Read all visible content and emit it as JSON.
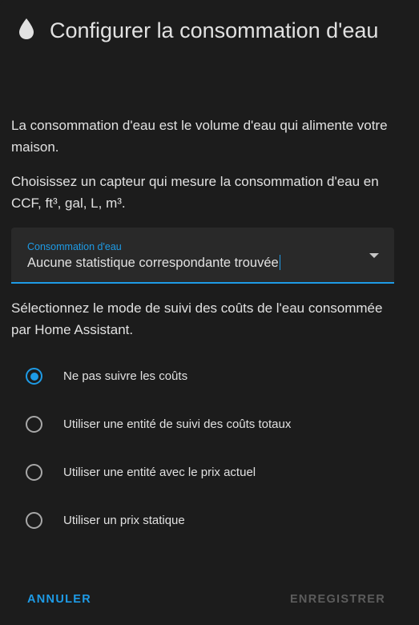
{
  "dialog": {
    "title": "Configurer la consommation d'eau",
    "title_icon": "water-drop-icon",
    "description": "La consommation d'eau est le volume d'eau qui alimente votre maison.",
    "sensor_hint": "Choisissez un capteur qui mesure la consommation d'eau en CCF, ft³, gal, L, m³.",
    "select": {
      "label": "Consommation d'eau",
      "value": "Aucune statistique correspondante trouvée"
    },
    "cost_intro": "Sélectionnez le mode de suivi des coûts de l'eau consommée par Home Assistant.",
    "cost_options": [
      {
        "label": "Ne pas suivre les coûts",
        "checked": true
      },
      {
        "label": "Utiliser une entité de suivi des coûts totaux",
        "checked": false
      },
      {
        "label": "Utiliser une entité avec le prix actuel",
        "checked": false
      },
      {
        "label": "Utiliser un prix statique",
        "checked": false
      }
    ],
    "buttons": {
      "cancel": "ANNULER",
      "save": "ENREGISTRER"
    },
    "colors": {
      "accent": "#1e9be6",
      "background": "#1c1c1c",
      "field_background": "#292929",
      "text": "#e1e1e1",
      "disabled": "#5c5c5c"
    }
  }
}
